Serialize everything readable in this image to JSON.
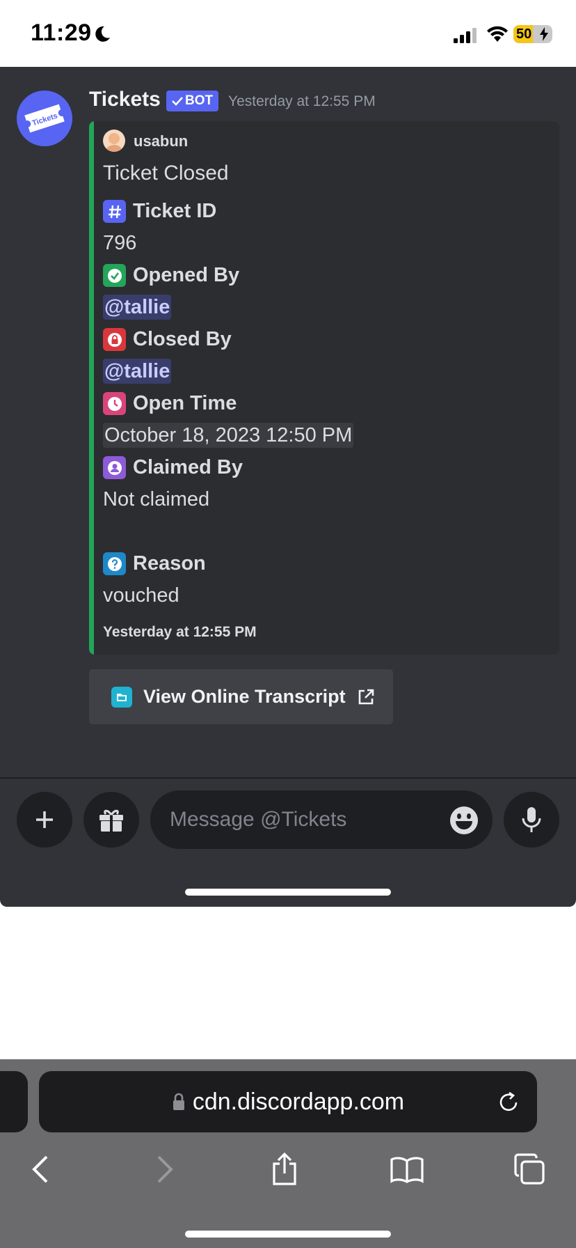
{
  "status_bar": {
    "time": "11:29",
    "battery": "50",
    "battery_level": 0.5
  },
  "message": {
    "author": "Tickets",
    "bot_badge": "BOT",
    "timestamp": "Yesterday at 12:55 PM",
    "avatar_text": "Tickets"
  },
  "embed": {
    "accent_color": "#23a55a",
    "author": "usabun",
    "title": "Ticket Closed",
    "fields": [
      {
        "name": "Ticket ID",
        "value": "796",
        "icon": "hashtag-icon",
        "icon_color": "#5865f2"
      },
      {
        "name": "Opened By",
        "value": "@tallie",
        "icon": "check-icon",
        "icon_color": "#23a55a"
      },
      {
        "name": "Closed By",
        "value": "@tallie",
        "icon": "lock-icon",
        "icon_color": "#da373c"
      },
      {
        "name": "Open Time",
        "value": "October 18, 2023 12:50 PM",
        "icon": "clock-icon",
        "icon_color": "#d8457a"
      },
      {
        "name": "Claimed By",
        "value": "Not claimed",
        "icon": "person-icon",
        "icon_color": "#8d5ad8"
      },
      {
        "name": "Reason",
        "value": "vouched",
        "icon": "question-icon",
        "icon_color": "#1e88c8"
      }
    ],
    "footer": "Yesterday at 12:55 PM"
  },
  "button": {
    "label": "View Online Transcript"
  },
  "composer": {
    "placeholder": "Message @Tickets"
  },
  "safari": {
    "url": "cdn.discordapp.com"
  }
}
